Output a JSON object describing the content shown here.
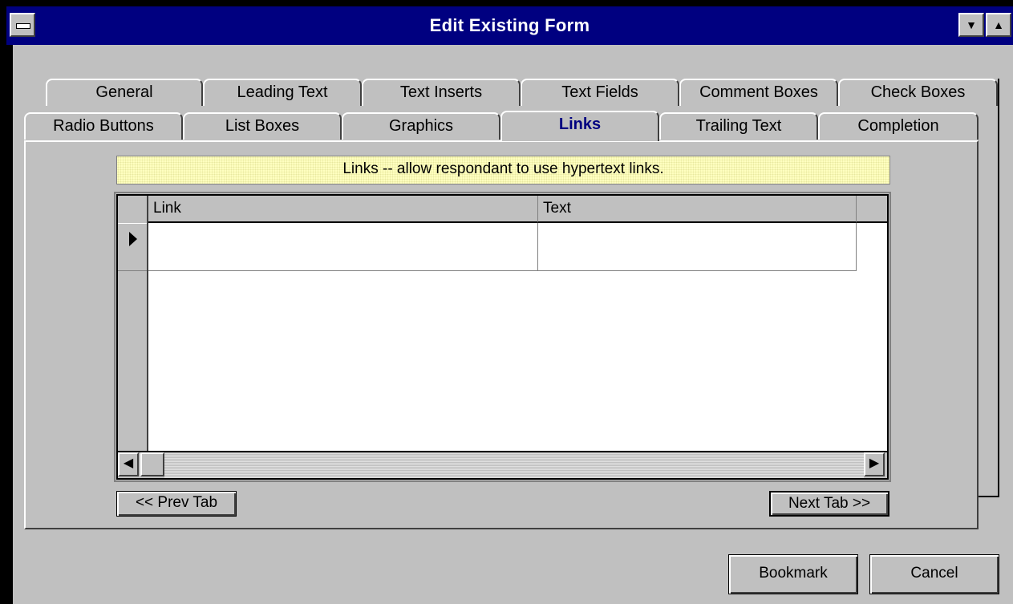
{
  "window": {
    "title": "Edit Existing Form",
    "system_menu_icon": "minus-icon",
    "min_icon": "down-triangle-icon",
    "max_icon": "up-triangle-icon"
  },
  "tabs": {
    "back_row": [
      "General",
      "Leading Text",
      "Text Inserts",
      "Text Fields",
      "Comment Boxes",
      "Check Boxes"
    ],
    "front_row": [
      "Radio Buttons",
      "List Boxes",
      "Graphics",
      "Links",
      "Trailing Text",
      "Completion"
    ],
    "active": "Links"
  },
  "panel": {
    "hint": "Links -- allow respondant to use hypertext links.",
    "grid": {
      "columns": [
        "Link",
        "Text"
      ],
      "rows": [
        [
          "",
          ""
        ]
      ]
    },
    "prev_label": "<< Prev Tab",
    "next_label": "Next Tab >>"
  },
  "footer": {
    "bookmark_label": "Bookmark",
    "cancel_label": "Cancel"
  },
  "colors": {
    "titlebar": "#000080",
    "face": "#c0c0c0",
    "active_tab_text": "#000080",
    "hint_bg": "#ffffc0"
  }
}
